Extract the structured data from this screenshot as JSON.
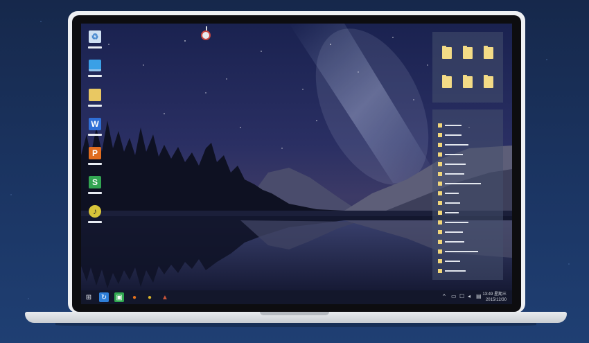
{
  "desktop": {
    "icons": [
      {
        "name": "recycle-bin",
        "glyph": "♻",
        "color": "#6fa3d8"
      },
      {
        "name": "computer",
        "glyph": "",
        "color": "#3aa0e6"
      },
      {
        "name": "document-folder",
        "glyph": "",
        "color": "#e9c862"
      },
      {
        "name": "wps-writer",
        "glyph": "W",
        "color": "#2f6fd6"
      },
      {
        "name": "wps-presentation",
        "glyph": "P",
        "color": "#e06c1f"
      },
      {
        "name": "wps-spreadsheet",
        "glyph": "S",
        "color": "#32a552"
      },
      {
        "name": "music-player",
        "glyph": "♪",
        "color": "#d8c53a"
      }
    ]
  },
  "taskbar": {
    "start_glyph": "⊞",
    "apps": [
      {
        "name": "recycle-app",
        "glyph": "↻",
        "color": "#2e7fd8"
      },
      {
        "name": "image-viewer",
        "glyph": "▣",
        "color": "#2fa84f"
      },
      {
        "name": "firefox",
        "glyph": "●",
        "color": "#e8731c"
      },
      {
        "name": "chrome",
        "glyph": "●",
        "color": "#d8b52a"
      },
      {
        "name": "installer",
        "glyph": "▲",
        "color": "#c8543a"
      }
    ],
    "clock_time": "13:49 星期三",
    "clock_date": "2015/12/30"
  },
  "colors": {
    "background": "#1b3563",
    "folder": "#f3db86"
  }
}
